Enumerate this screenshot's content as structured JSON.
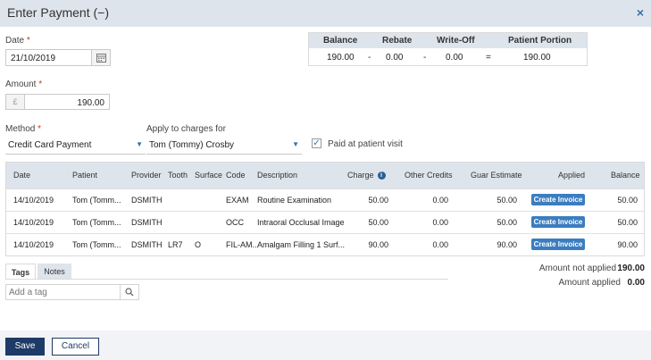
{
  "dialog": {
    "title": "Enter Payment (−)",
    "close_label": "×"
  },
  "date": {
    "label": "Date",
    "required": "*",
    "value": "21/10/2019"
  },
  "amount": {
    "label": "Amount",
    "required": "*",
    "currency": "£",
    "value": "190.00"
  },
  "method": {
    "label": "Method",
    "required": "*",
    "value": "Credit Card Payment"
  },
  "apply_to": {
    "label": "Apply to charges for",
    "value": "Tom (Tommy) Crosby"
  },
  "paid_at_visit": {
    "label": "Paid at patient visit",
    "checked": true
  },
  "summary": {
    "headers": {
      "balance": "Balance",
      "rebate": "Rebate",
      "writeoff": "Write-Off",
      "portion": "Patient Portion"
    },
    "values": {
      "balance": "190.00",
      "rebate": "0.00",
      "writeoff": "0.00",
      "portion": "190.00"
    },
    "ops": {
      "minus1": "-",
      "minus2": "-",
      "equals": "="
    }
  },
  "grid": {
    "headers": {
      "date": "Date",
      "patient": "Patient",
      "provider": "Provider",
      "tooth": "Tooth",
      "surface": "Surface",
      "code": "Code",
      "description": "Description",
      "charge": "Charge",
      "other_credits": "Other Credits",
      "guar_estimate": "Guar Estimate",
      "applied": "Applied",
      "balance": "Balance"
    },
    "info_icon": "i",
    "rows": [
      {
        "date": "14/10/2019",
        "patient": "Tom (Tomm...",
        "provider": "DSMITH",
        "tooth": "",
        "surface": "",
        "code": "EXAM",
        "description": "Routine Examination",
        "charge": "50.00",
        "other_credits": "0.00",
        "guar_estimate": "50.00",
        "applied": "Create Invoice",
        "balance": "50.00"
      },
      {
        "date": "14/10/2019",
        "patient": "Tom (Tomm...",
        "provider": "DSMITH",
        "tooth": "",
        "surface": "",
        "code": "OCC",
        "description": "Intraoral Occlusal Image",
        "charge": "50.00",
        "other_credits": "0.00",
        "guar_estimate": "50.00",
        "applied": "Create Invoice",
        "balance": "50.00"
      },
      {
        "date": "14/10/2019",
        "patient": "Tom (Tomm...",
        "provider": "DSMITH",
        "tooth": "LR7",
        "surface": "O",
        "code": "FIL-AM...",
        "description": "Amalgam Filling 1 Surf...",
        "charge": "90.00",
        "other_credits": "0.00",
        "guar_estimate": "90.00",
        "applied": "Create Invoice",
        "balance": "90.00"
      }
    ]
  },
  "tabs": {
    "tags": "Tags",
    "notes": "Notes"
  },
  "tag_input": {
    "placeholder": "Add a tag"
  },
  "totals": {
    "not_applied_label": "Amount not applied",
    "not_applied_value": "190.00",
    "applied_label": "Amount applied",
    "applied_value": "0.00"
  },
  "buttons": {
    "save": "Save",
    "cancel": "Cancel"
  },
  "colors": {
    "header_bg": "#dde4ec",
    "primary": "#1e3a66",
    "button_blue": "#3b7dbf",
    "required": "#c0392b"
  }
}
